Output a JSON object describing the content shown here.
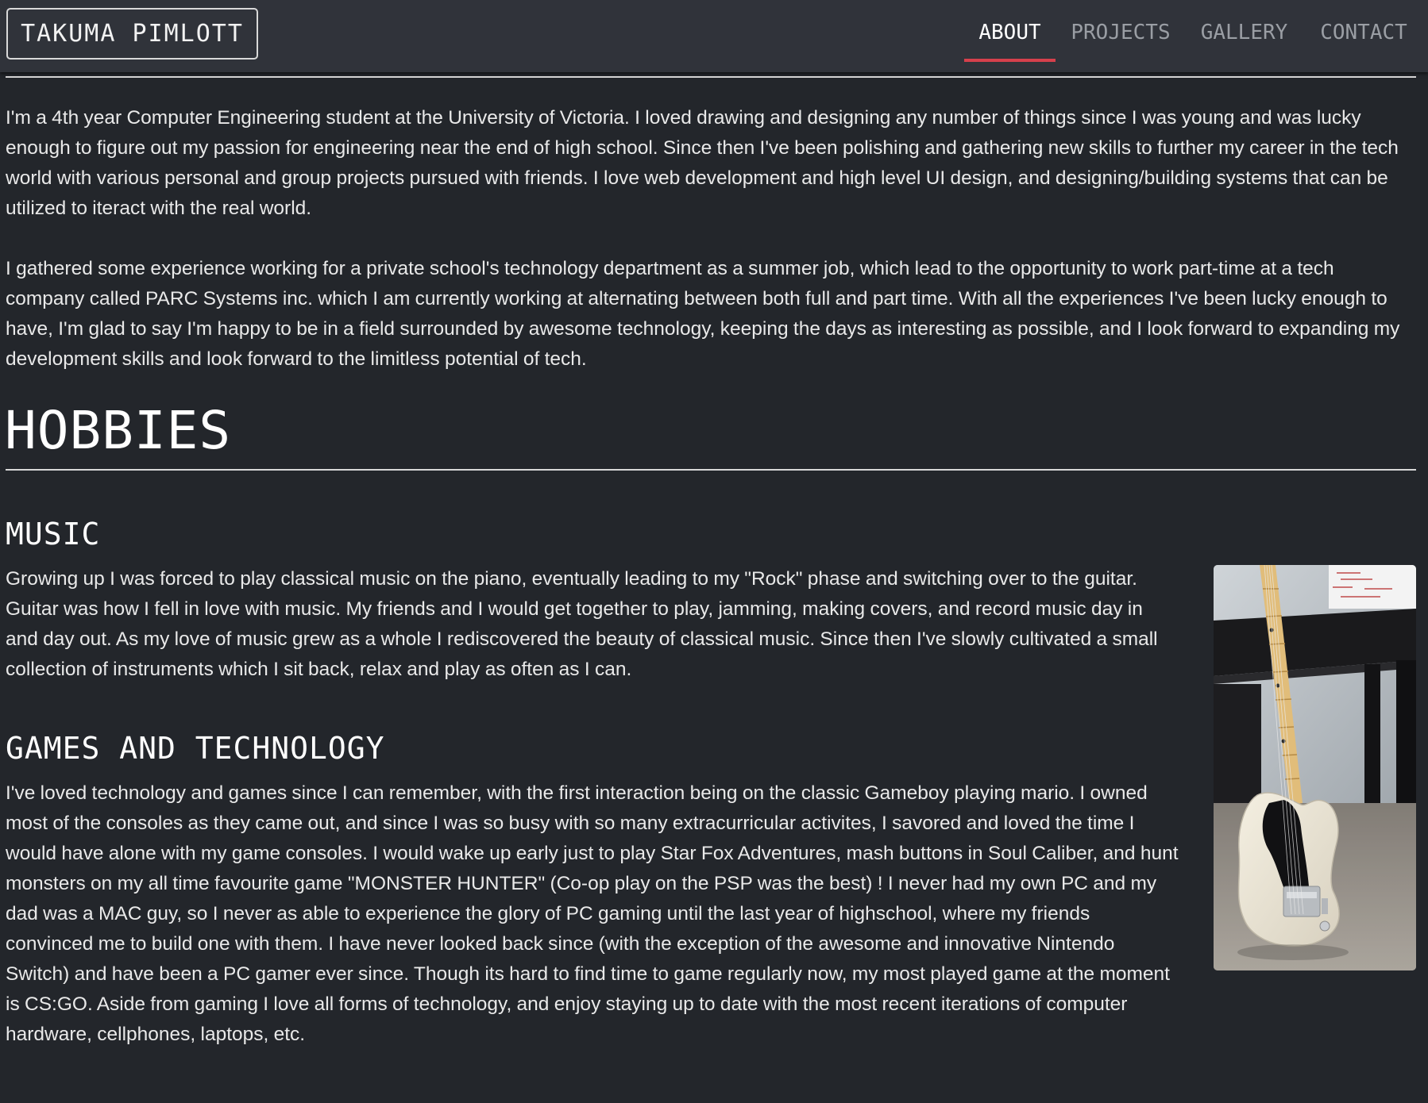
{
  "navbar": {
    "brand": "TAKUMA PIMLOTT",
    "items": [
      {
        "label": "ABOUT",
        "active": true
      },
      {
        "label": "PROJECTS",
        "active": false
      },
      {
        "label": "GALLERY",
        "active": false
      },
      {
        "label": "CONTACT",
        "active": false
      }
    ],
    "active_indicator_color": "#d6404c"
  },
  "about": {
    "paragraphs": [
      "I'm a 4th year Computer Engineering student at the University of Victoria. I loved drawing and designing any number of things since I was young and was lucky enough to figure out my passion for engineering near the end of high school. Since then I've been polishing and gathering new skills to further my career in the tech world with various personal and group projects pursued with friends. I love web development and high level UI design, and designing/building systems that can be utilized to iteract with the real world.",
      "I gathered some experience working for a private school's technology department as a summer job, which lead to the opportunity to work part-time at a tech company called PARC Systems inc. which I am currently working at alternating between both full and part time. With all the experiences I've been lucky enough to have, I'm glad to say I'm happy to be in a field surrounded by awesome technology, keeping the days as interesting as possible, and I look forward to expanding my development skills and look forward to the limitless potential of tech."
    ]
  },
  "hobbies": {
    "title": "HOBBIES",
    "sections": [
      {
        "heading": "MUSIC",
        "text": "Growing up I was forced to play classical music on the piano, eventually leading to my \"Rock\" phase and switching over to the guitar. Guitar was how I fell in love with music. My friends and I would get together to play, jamming, making covers, and record music day in and day out. As my love of music grew as a whole I rediscovered the beauty of classical music. Since then I've slowly cultivated a small collection of instruments which I sit back, relax and play as often as I can."
      },
      {
        "heading": "GAMES AND TECHNOLOGY",
        "text": "I've loved technology and games since I can remember, with the first interaction being on the classic Gameboy playing mario. I owned most of the consoles as they came out, and since I was so busy with so many extracurricular activites, I savored and loved the time I would have alone with my game consoles. I would wake up early just to play Star Fox Adventures, mash buttons in Soul Caliber, and hunt monsters on my all time favourite game \"MONSTER HUNTER\" (Co-op play on the PSP was the best) ! I never had my own PC and my dad was a MAC guy, so I never as able to experience the glory of PC gaming until the last year of highschool, where my friends convinced me to build one with them. I have never looked back since (with the exception of the awesome and innovative Nintendo Switch) and have been a PC gamer ever since. Though its hard to find time to game regularly now, my most played game at the moment is CS:GO. Aside from gaming I love all forms of technology, and enjoy staying up to date with the most recent iterations of computer hardware, cellphones, laptops, etc."
      }
    ],
    "photo": {
      "subject": "guitar-photo"
    }
  },
  "colors": {
    "page_background": "#23262b",
    "navbar_background": "#30333a",
    "text": "#e9e9e9",
    "nav_inactive": "#9a9ea4"
  }
}
